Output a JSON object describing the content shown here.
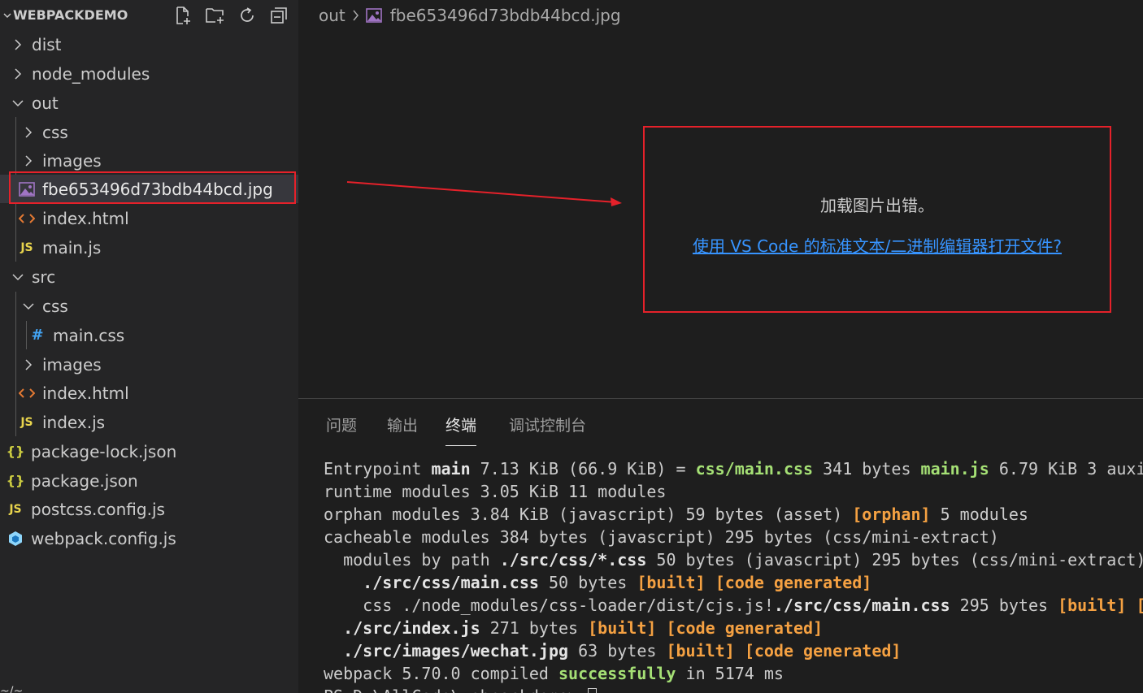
{
  "explorer": {
    "title": "WEBPACKDEMO",
    "actions": [
      {
        "name": "new-file-icon"
      },
      {
        "name": "new-folder-icon"
      },
      {
        "name": "refresh-icon"
      },
      {
        "name": "collapse-all-icon"
      }
    ],
    "items": [
      {
        "label": "dist",
        "type": "folder",
        "expanded": false
      },
      {
        "label": "node_modules",
        "type": "folder",
        "expanded": false
      },
      {
        "label": "out",
        "type": "folder",
        "expanded": true
      },
      {
        "label": "css",
        "type": "folder",
        "expanded": false
      },
      {
        "label": "images",
        "type": "folder",
        "expanded": false
      },
      {
        "label": "fbe653496d73bdb44bcd.jpg",
        "type": "image",
        "icon": "image-file-icon"
      },
      {
        "label": "index.html",
        "type": "html",
        "icon": "html-file-icon"
      },
      {
        "label": "main.js",
        "type": "js",
        "icon": "js-file-icon",
        "icon_text": "JS"
      },
      {
        "label": "src",
        "type": "folder",
        "expanded": true
      },
      {
        "label": "css",
        "type": "folder",
        "expanded": true
      },
      {
        "label": "main.css",
        "type": "css",
        "icon": "css-file-icon",
        "icon_text": "#"
      },
      {
        "label": "images",
        "type": "folder",
        "expanded": false
      },
      {
        "label": "index.html",
        "type": "html",
        "icon": "html-file-icon"
      },
      {
        "label": "index.js",
        "type": "js",
        "icon": "js-file-icon",
        "icon_text": "JS"
      },
      {
        "label": "package-lock.json",
        "type": "json",
        "icon": "json-file-icon",
        "icon_text": "{}"
      },
      {
        "label": "package.json",
        "type": "json",
        "icon": "json-file-icon",
        "icon_text": "{}"
      },
      {
        "label": "postcss.config.js",
        "type": "js",
        "icon": "js-file-icon",
        "icon_text": "JS"
      },
      {
        "label": "webpack.config.js",
        "type": "webpack",
        "icon": "webpack-icon"
      }
    ],
    "bottom_fragment": "~/~"
  },
  "breadcrumb": {
    "folder": "out",
    "file": "fbe653496d73bdb44bcd.jpg"
  },
  "image_error": {
    "message": "加载图片出错。",
    "link": "使用 VS Code 的标准文本/二进制编辑器打开文件?"
  },
  "panel": {
    "tabs": [
      "问题",
      "输出",
      "终端",
      "调试控制台"
    ],
    "active_tab": "终端"
  },
  "terminal": {
    "lines": [
      [
        [
          "",
          "Entrypoint "
        ],
        [
          "b",
          "main"
        ],
        [
          "",
          " 7.13 KiB (66.9 KiB) = "
        ],
        [
          "g",
          "css/main.css"
        ],
        [
          "",
          " 341 bytes "
        ],
        [
          "g",
          "main.js"
        ],
        [
          "",
          " 6.79 KiB 3 auxi"
        ]
      ],
      [
        [
          "",
          "runtime modules 3.05 KiB 11 modules"
        ]
      ],
      [
        [
          "",
          "orphan modules 3.84 KiB (javascript) 59 bytes (asset) "
        ],
        [
          "y",
          "[orphan]"
        ],
        [
          "",
          " 5 modules"
        ]
      ],
      [
        [
          "",
          "cacheable modules 384 bytes (javascript) 295 bytes (css/mini-extract)"
        ]
      ],
      [
        [
          "",
          "  modules by path "
        ],
        [
          "b",
          "./src/css/*.css"
        ],
        [
          "",
          " 50 bytes (javascript) 295 bytes (css/mini-extract)"
        ]
      ],
      [
        [
          "",
          "    "
        ],
        [
          "b",
          "./src/css/main.css"
        ],
        [
          "",
          " 50 bytes "
        ],
        [
          "y",
          "[built]"
        ],
        [
          "",
          " "
        ],
        [
          "y",
          "[code generated]"
        ]
      ],
      [
        [
          "",
          "    css ./node_modules/css-loader/dist/cjs.js!"
        ],
        [
          "b",
          "./src/css/main.css"
        ],
        [
          "",
          " 295 bytes "
        ],
        [
          "y",
          "[built]"
        ],
        [
          "",
          " "
        ],
        [
          "y",
          "["
        ]
      ],
      [
        [
          "",
          "  "
        ],
        [
          "b",
          "./src/index.js"
        ],
        [
          "",
          " 271 bytes "
        ],
        [
          "y",
          "[built]"
        ],
        [
          "",
          " "
        ],
        [
          "y",
          "[code generated]"
        ]
      ],
      [
        [
          "",
          "  "
        ],
        [
          "b",
          "./src/images/wechat.jpg"
        ],
        [
          "",
          " 63 bytes "
        ],
        [
          "y",
          "[built]"
        ],
        [
          "",
          " "
        ],
        [
          "y",
          "[code generated]"
        ]
      ],
      [
        [
          "",
          "webpack 5.70.0 compiled "
        ],
        [
          "g",
          "successfully"
        ],
        [
          "",
          " in 5174 ms"
        ]
      ],
      [
        [
          "",
          "PS D:\\AllCode\\webpackdemo> "
        ]
      ]
    ]
  },
  "colors": {
    "accent_red": "#e5212a",
    "link": "#3794ff",
    "js": "#e8d44d",
    "html": "#e37933",
    "css": "#42a5f5",
    "json": "#cbcb41",
    "image": "#a074c4",
    "webpack": "#8ed6fb"
  }
}
